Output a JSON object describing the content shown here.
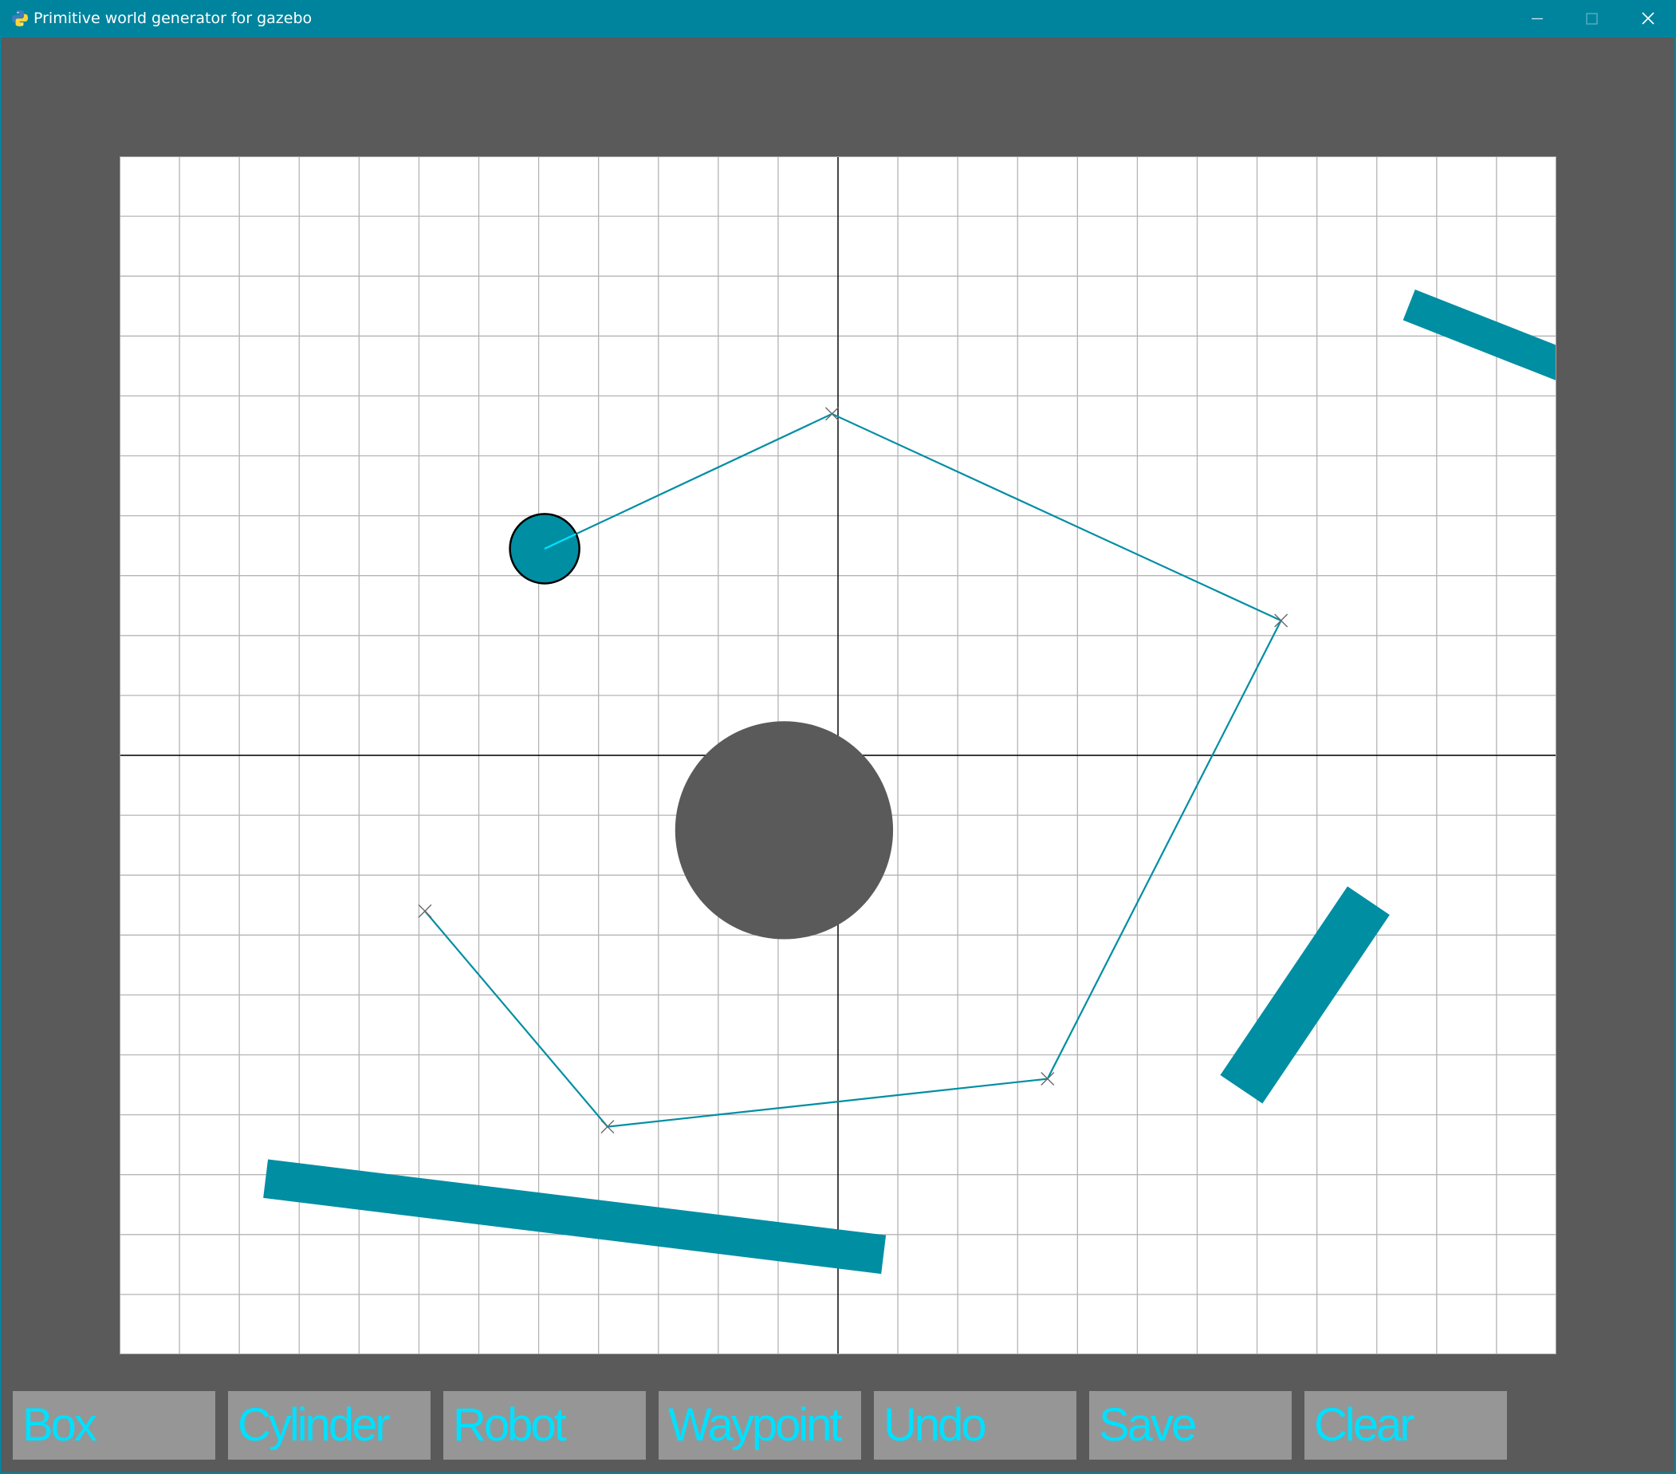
{
  "window": {
    "title": "Primitive world generator for gazebo",
    "title_color": "#ffffff",
    "frame_color": "#00849e"
  },
  "theme": {
    "background": "#5a5a5a",
    "accent": "#008ea3",
    "button_bg": "#969696",
    "button_text": "#00e0ff",
    "grid_line": "#b4b4b4",
    "axis_line": "#000000",
    "canvas_bg": "#ffffff"
  },
  "icons": {
    "app": "python-icon",
    "minimize": "minimize-icon",
    "maximize": "maximize-icon",
    "close": "close-icon"
  },
  "toolbar": {
    "buttons": [
      {
        "id": "box",
        "label": "Box"
      },
      {
        "id": "cylinder",
        "label": "Cylinder"
      },
      {
        "id": "robot",
        "label": "Robot"
      },
      {
        "id": "waypoint",
        "label": "Waypoint"
      },
      {
        "id": "undo",
        "label": "Undo"
      },
      {
        "id": "save",
        "label": "Save"
      },
      {
        "id": "clear",
        "label": "Clear"
      }
    ]
  },
  "world": {
    "grid": {
      "cols": 24,
      "rows": 20
    },
    "boxes": [
      {
        "cx": 13.4,
        "cy": 6.0,
        "length": 8.3,
        "width": 0.55,
        "angle_deg": -21.5
      },
      {
        "cx": -4.4,
        "cy": -7.7,
        "length": 10.4,
        "width": 0.65,
        "angle_deg": -7.0
      },
      {
        "cx": 7.8,
        "cy": -4.0,
        "length": 3.8,
        "width": 0.85,
        "angle_deg": 56.0
      }
    ],
    "cylinders": [
      {
        "cx": -0.9,
        "cy": -1.25,
        "r": 1.82
      }
    ],
    "robot": {
      "cx": -4.9,
      "cy": 3.45,
      "r": 0.58
    },
    "waypoints": [
      {
        "x": -4.9,
        "y": 3.45
      },
      {
        "x": -0.1,
        "y": 5.7
      },
      {
        "x": 7.4,
        "y": 2.25
      },
      {
        "x": 3.5,
        "y": -5.4
      },
      {
        "x": -3.85,
        "y": -6.2
      },
      {
        "x": -6.9,
        "y": -2.6
      }
    ]
  }
}
